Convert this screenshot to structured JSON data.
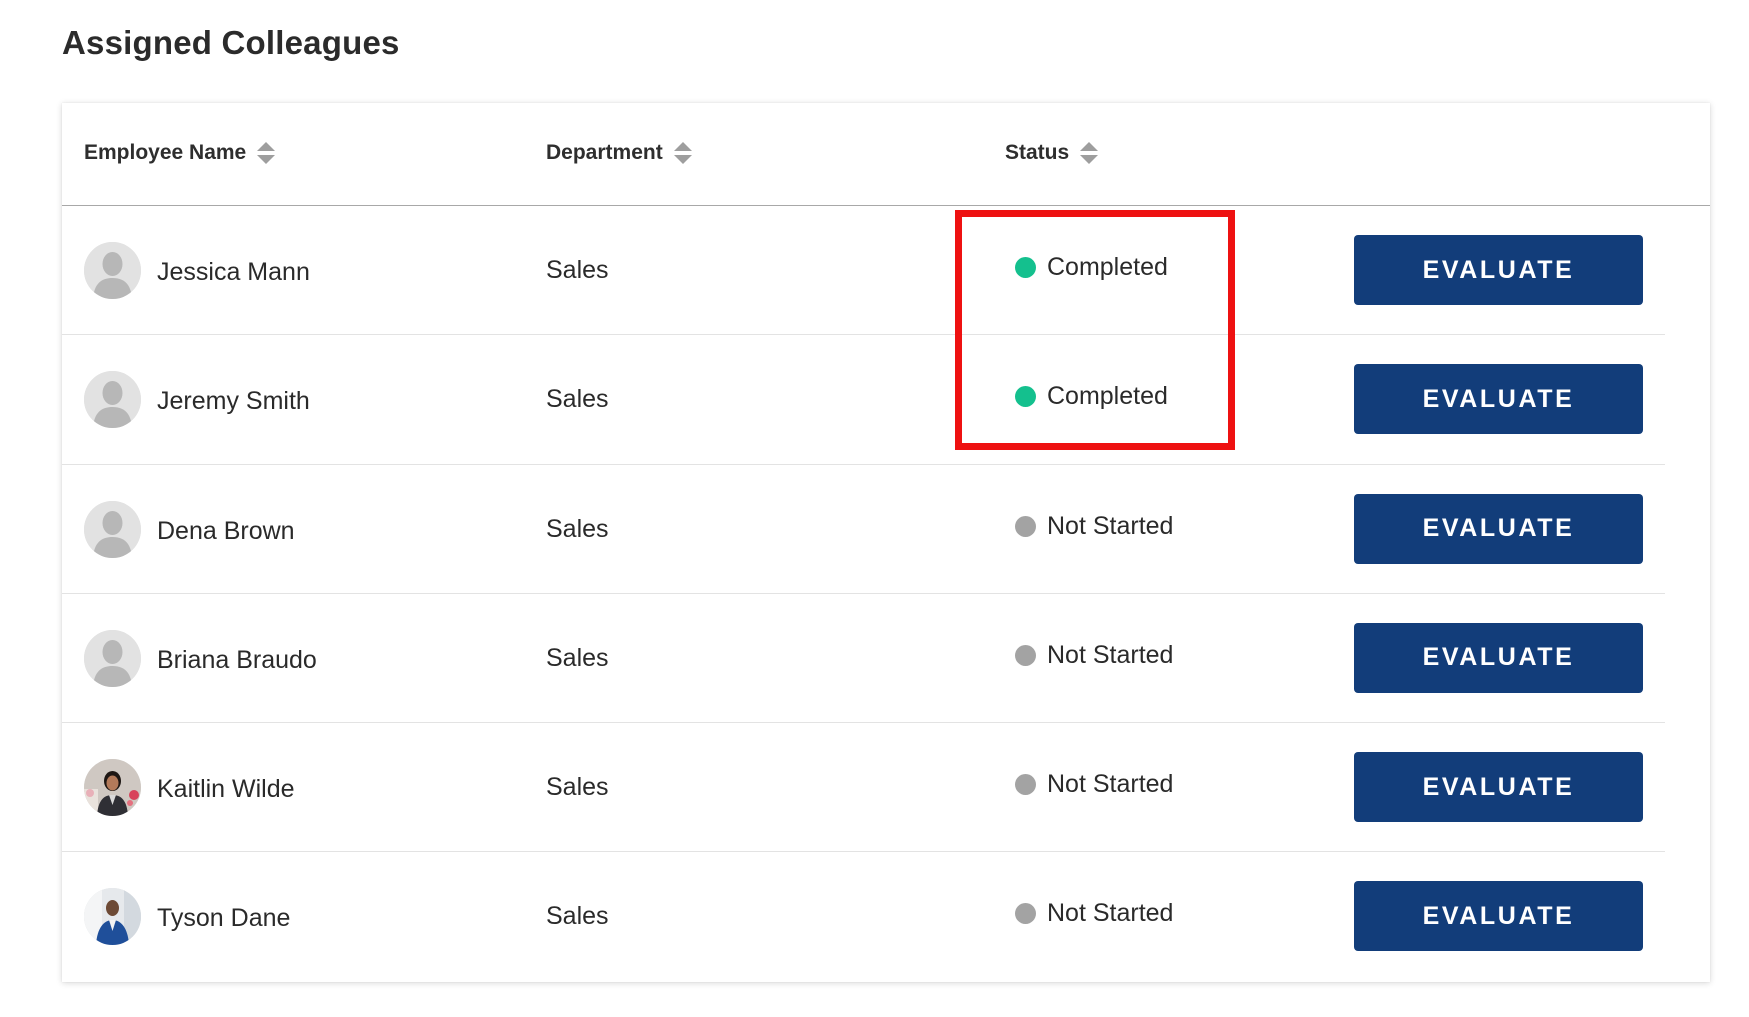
{
  "page_title": "Assigned Colleagues",
  "table": {
    "columns": [
      {
        "label": "Employee Name",
        "sortable": true
      },
      {
        "label": "Department",
        "sortable": true
      },
      {
        "label": "Status",
        "sortable": true
      }
    ],
    "rows": [
      {
        "name": "Jessica Mann",
        "department": "Sales",
        "status": "Completed",
        "status_color": "#14c08e",
        "avatar": "placeholder-avatar-icon",
        "action": "EVALUATE"
      },
      {
        "name": "Jeremy Smith",
        "department": "Sales",
        "status": "Completed",
        "status_color": "#14c08e",
        "avatar": "placeholder-avatar-icon",
        "action": "EVALUATE"
      },
      {
        "name": "Dena Brown",
        "department": "Sales",
        "status": "Not Started",
        "status_color": "#a3a3a3",
        "avatar": "placeholder-avatar-icon",
        "action": "EVALUATE"
      },
      {
        "name": "Briana Braudo",
        "department": "Sales",
        "status": "Not Started",
        "status_color": "#a3a3a3",
        "avatar": "placeholder-avatar-icon",
        "action": "EVALUATE"
      },
      {
        "name": "Kaitlin Wilde",
        "department": "Sales",
        "status": "Not Started",
        "status_color": "#a3a3a3",
        "avatar": "photo-avatar",
        "action": "EVALUATE"
      },
      {
        "name": "Tyson Dane",
        "department": "Sales",
        "status": "Not Started",
        "status_color": "#a3a3a3",
        "avatar": "photo-avatar",
        "action": "EVALUATE"
      }
    ]
  },
  "colors": {
    "button_bg": "#123d7a",
    "completed": "#14c08e",
    "not_started": "#a3a3a3",
    "highlight": "#ee1111"
  }
}
